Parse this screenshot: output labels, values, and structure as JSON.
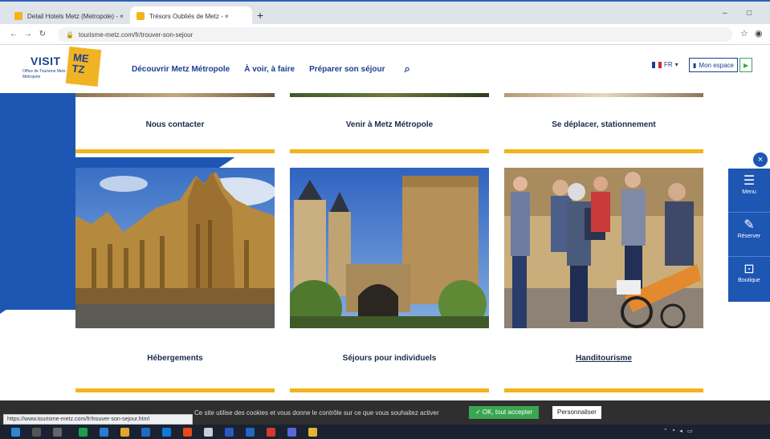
{
  "browser": {
    "tabs": [
      {
        "title": "Detail Hotels Metz (Metropole) - ×",
        "active": false
      },
      {
        "title": "Trésors Oubliés de Metz - ×",
        "active": true
      }
    ],
    "url": "tourisme-metz.com/fr/trouver-son-sejour",
    "win_min": "–",
    "win_max": "□"
  },
  "header": {
    "logo_visit": "VISIT",
    "logo_me": "ME",
    "logo_tz": "TZ",
    "logo_sub": "Office de Tourisme Metz Métropole",
    "nav": [
      "Découvrir Metz Métropole",
      "À voir, à faire",
      "Préparer son séjour"
    ],
    "lang": "FR",
    "btn_account": "Mon espace"
  },
  "top_cards": [
    {
      "label": "Nous contacter"
    },
    {
      "label": "Venir à Metz Métropole"
    },
    {
      "label": "Se déplacer, stationnement"
    }
  ],
  "photo_cards": [
    {
      "label": "Hébergements",
      "linked": false
    },
    {
      "label": "Séjours pour individuels",
      "linked": false
    },
    {
      "label": "Handitourisme",
      "linked": true
    }
  ],
  "sidebar": [
    {
      "label": "Menu",
      "icon": "menu-icon"
    },
    {
      "label": "Réserver",
      "icon": "pen-icon"
    },
    {
      "label": "Boutique",
      "icon": "bag-icon"
    }
  ],
  "cookie": {
    "text": "Ce site utilise des cookies et vous donne le contrôle sur ce que vous souhaitez activer",
    "ok": "✓ OK, tout accepter",
    "custom": "Personnaliser"
  },
  "status_url": "https://www.tourisme-metz.com/fr/trouver-son-sejour.html",
  "colors": {
    "brand_blue": "#1d56b3",
    "accent_yellow": "#f3b41b",
    "cookie_green": "#3aa651"
  }
}
